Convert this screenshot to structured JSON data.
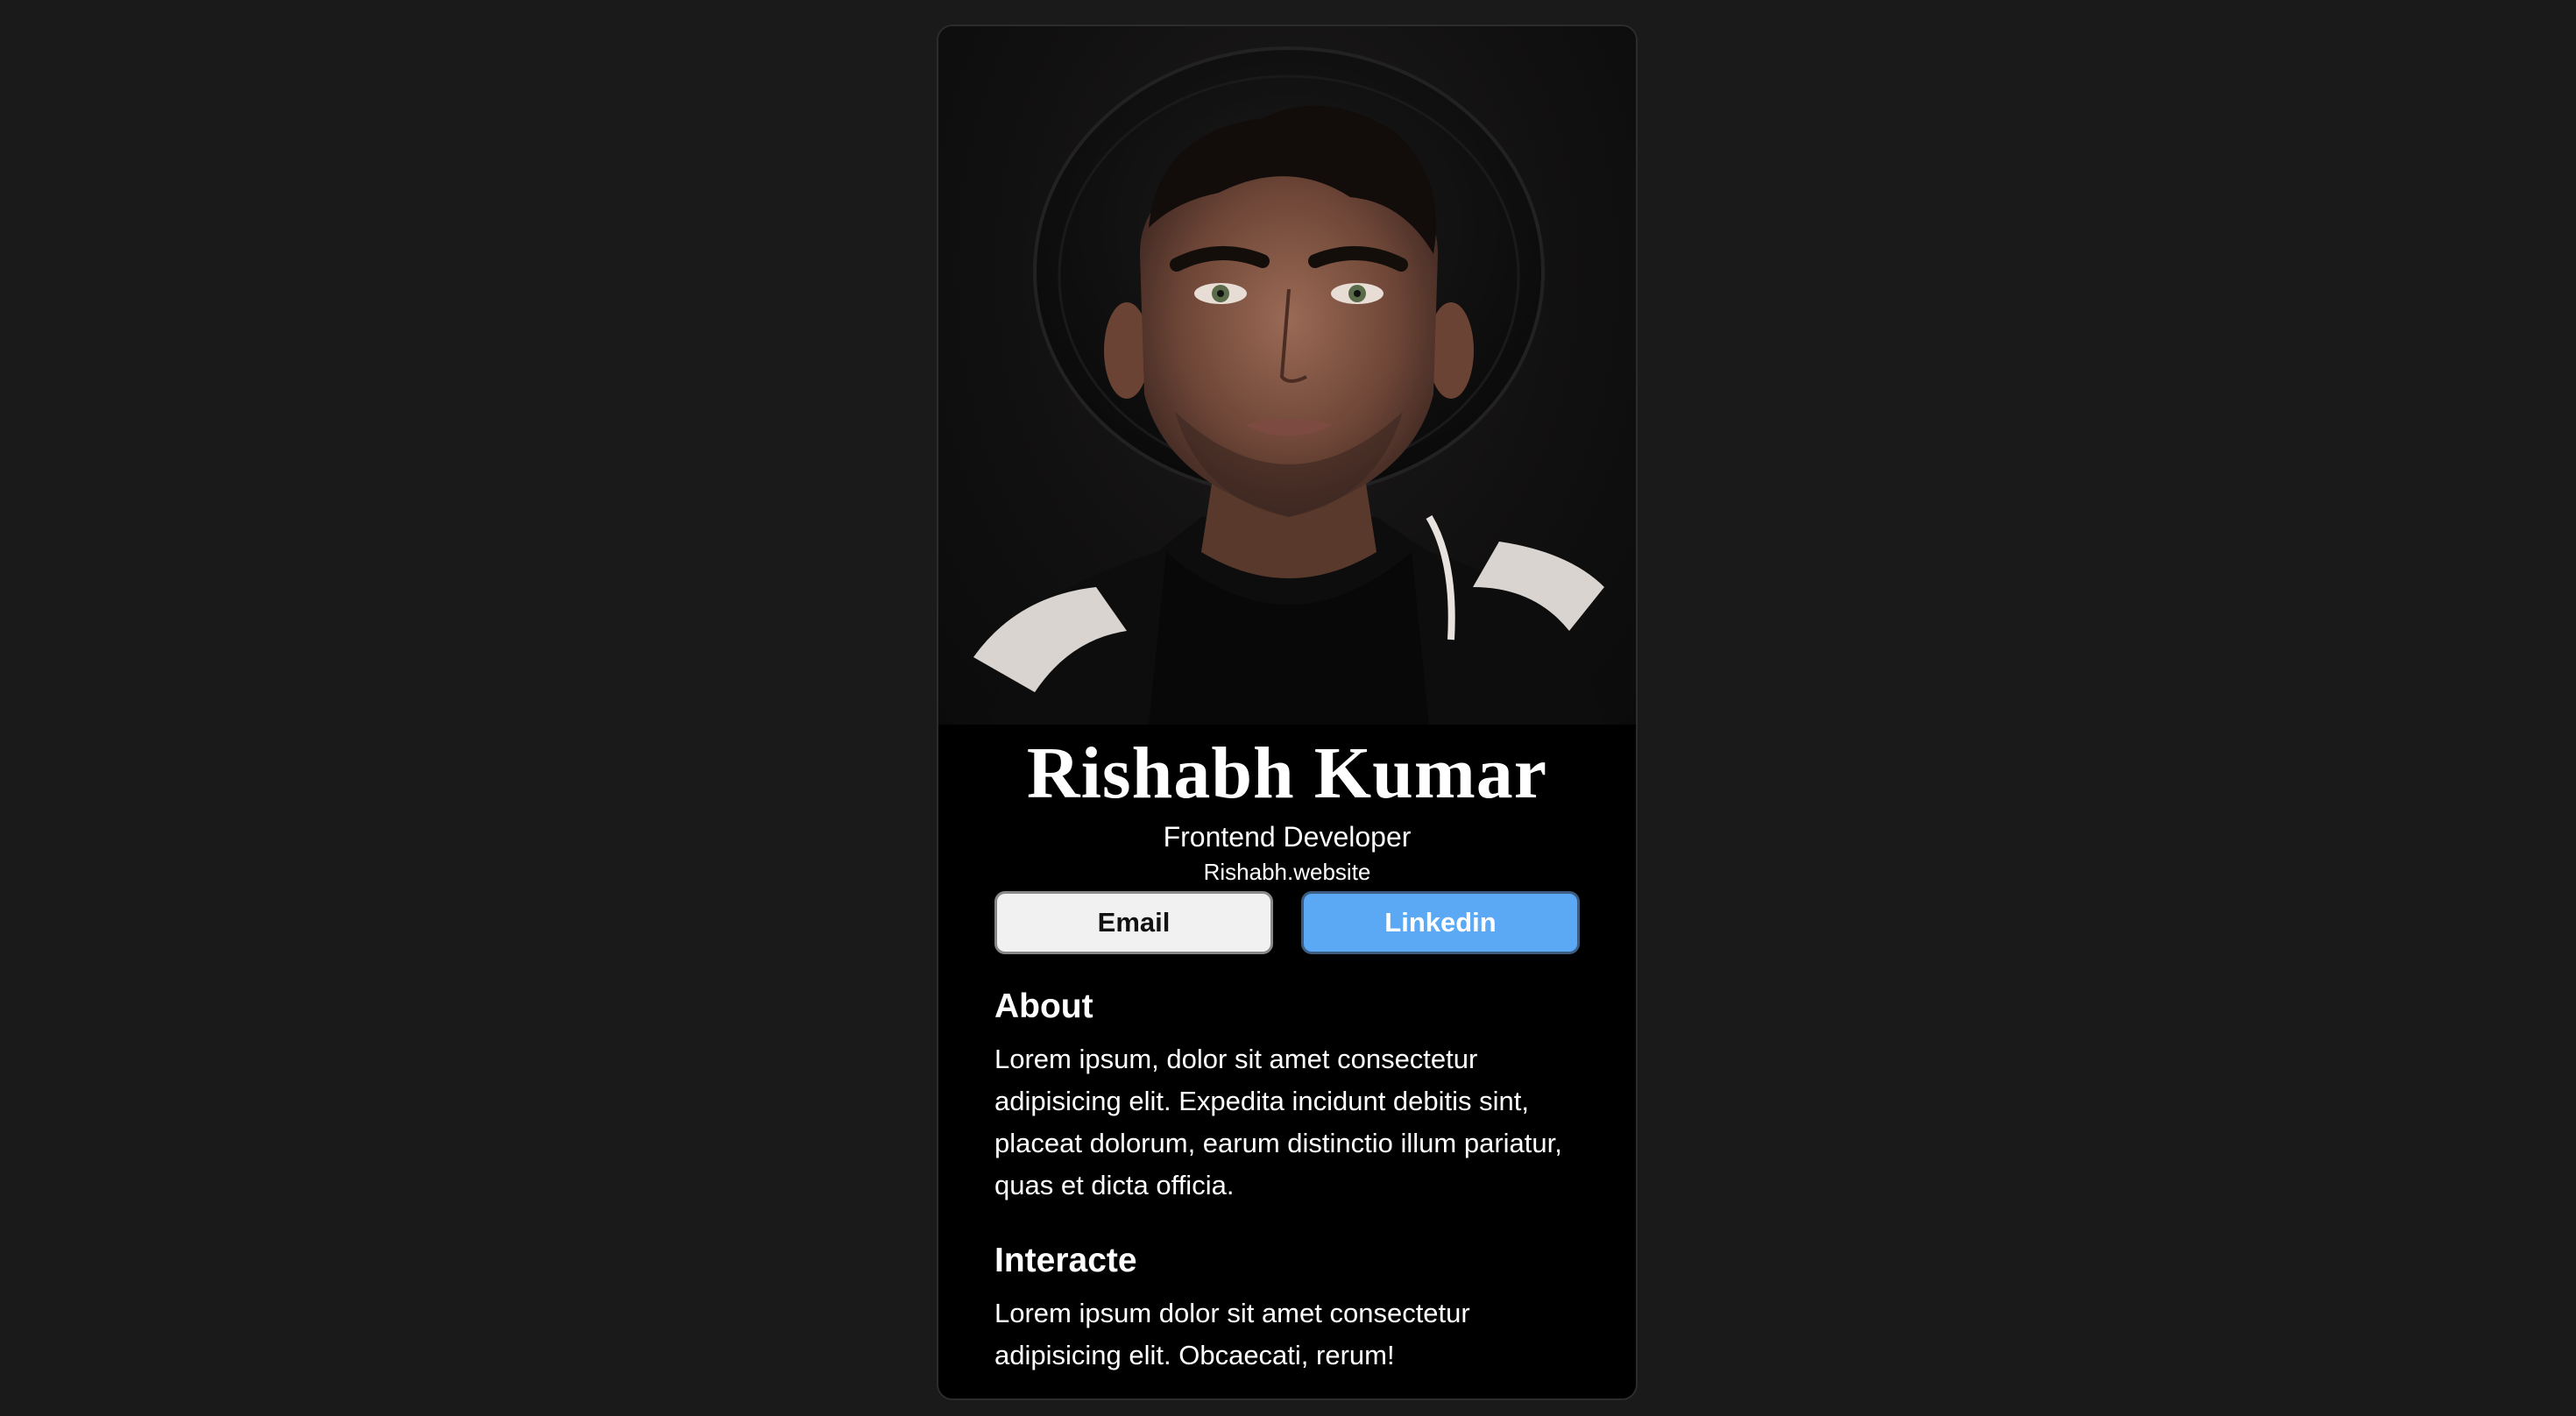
{
  "profile": {
    "name": "Rishabh Kumar",
    "role": "Frontend Developer",
    "website": "Rishabh.website",
    "photo_alt": "portrait"
  },
  "buttons": {
    "email_label": "Email",
    "linkedin_label": "Linkedin"
  },
  "about": {
    "title": "About",
    "text": "Lorem ipsum, dolor sit amet consectetur adipisicing elit. Expedita incidunt debitis sint, placeat dolorum, earum distinctio illum pariatur, quas et dicta officia."
  },
  "interests": {
    "title": "Interacte",
    "text": "Lorem ipsum dolor sit amet consectetur adipisicing elit. Obcaecati, rerum!"
  },
  "colors": {
    "page_background": "#1a1a1a",
    "card_background": "#000000",
    "email_button": "#f1f1f1",
    "linkedin_button": "#5ba8f5"
  }
}
